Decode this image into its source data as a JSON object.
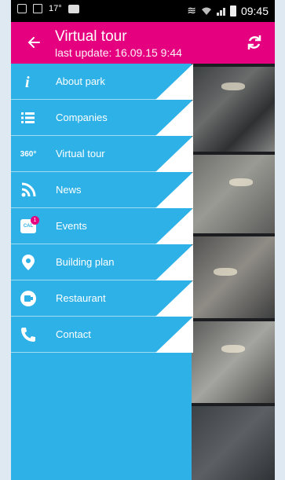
{
  "status_bar": {
    "left_text": "17°",
    "time": "09:45",
    "icons": [
      "download-icon",
      "image-icon",
      "temperature",
      "bag-icon",
      "mute-vibrate-icon",
      "wifi-icon",
      "signal-icon",
      "battery-icon"
    ]
  },
  "app_bar": {
    "title": "Virtual tour",
    "subtitle": "last update: 16.09.15 9:44",
    "back_icon": "arrow-left-icon",
    "refresh_icon": "refresh-icon",
    "background_color": "#e5007f"
  },
  "drawer": {
    "background_color": "#2db1e7",
    "items": [
      {
        "label": "About park",
        "icon": "info-icon"
      },
      {
        "label": "Companies",
        "icon": "list-icon"
      },
      {
        "label": "Virtual tour",
        "icon": "360-icon",
        "icon_text": "360°"
      },
      {
        "label": "News",
        "icon": "rss-icon"
      },
      {
        "label": "Events",
        "icon": "calendar-icon",
        "icon_text": "CAL",
        "badge": "1"
      },
      {
        "label": "Building plan",
        "icon": "location-pin-icon"
      },
      {
        "label": "Restaurant",
        "icon": "cup-icon"
      },
      {
        "label": "Contact",
        "icon": "phone-icon"
      }
    ]
  }
}
